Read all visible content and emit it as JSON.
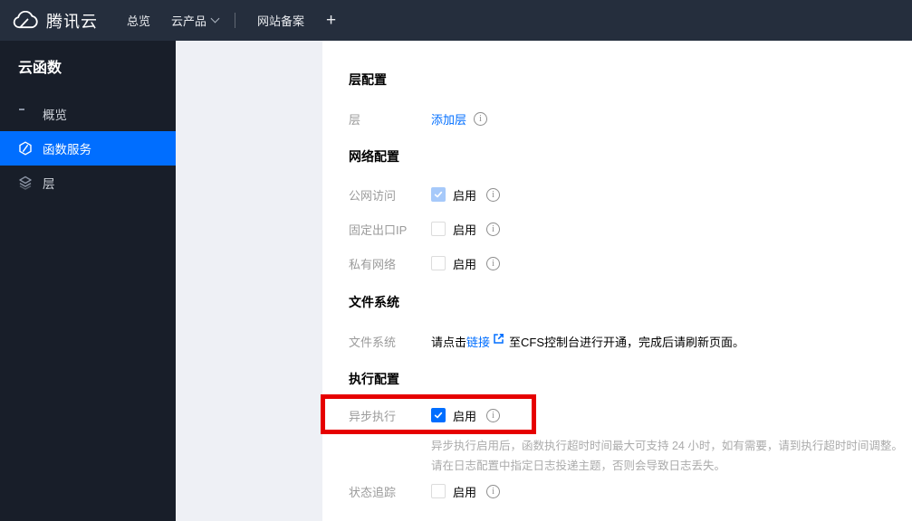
{
  "topbar": {
    "brand": "腾讯云",
    "nav": [
      {
        "label": "总览"
      },
      {
        "label": "云产品"
      },
      {
        "label": "网站备案"
      }
    ],
    "add_label": "+"
  },
  "sidebar": {
    "title": "云函数",
    "items": [
      {
        "label": "概览",
        "icon": "grid-icon",
        "active": false
      },
      {
        "label": "函数服务",
        "icon": "function-hexagon-icon",
        "active": true
      },
      {
        "label": "层",
        "icon": "layers-icon",
        "active": false
      }
    ]
  },
  "content": {
    "layer_section": {
      "header": "层配置",
      "row_label": "层",
      "add_layer_link": "添加层"
    },
    "network_section": {
      "header": "网络配置",
      "rows": [
        {
          "label": "公网访问",
          "enable": "启用",
          "state": "checked-disabled"
        },
        {
          "label": "固定出口IP",
          "enable": "启用",
          "state": "unchecked"
        },
        {
          "label": "私有网络",
          "enable": "启用",
          "state": "unchecked"
        }
      ]
    },
    "filesystem_section": {
      "header": "文件系统",
      "row_label": "文件系统",
      "text_before": "请点击",
      "link_text": "链接",
      "text_after": "至CFS控制台进行开通，完成后请刷新页面。"
    },
    "execution_section": {
      "header": "执行配置",
      "async_label": "异步执行",
      "async_enable": "启用",
      "async_state": "checked",
      "help_line1": "异步执行启用后，函数执行超时时间最大可支持 24 小时，如有需要，请到执行超时时间调整。",
      "help_line2": "请在日志配置中指定日志投递主题，否则会导致日志丢失。",
      "status_label": "状态追踪",
      "status_enable": "启用",
      "status_state": "unchecked"
    }
  },
  "icons": {
    "info_glyph": "i"
  },
  "colors": {
    "accent_blue": "#006eff",
    "annotation_red": "#e60000",
    "disabled_check_blue": "#a6c9fa",
    "topbar_bg": "#252e3d",
    "sidebar_bg": "#181e29",
    "panel_gray": "#eef0f5"
  }
}
